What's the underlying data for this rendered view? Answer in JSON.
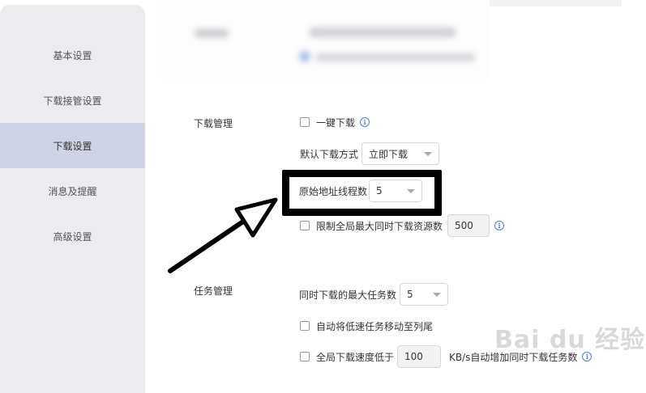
{
  "sidebar": {
    "items": [
      {
        "label": "基本设置"
      },
      {
        "label": "下载接管设置"
      },
      {
        "label": "下载设置"
      },
      {
        "label": "消息及提醒"
      },
      {
        "label": "高级设置"
      }
    ],
    "active_index": 2
  },
  "download_management": {
    "section_label": "下载管理",
    "one_click_download": {
      "label": "一键下载",
      "checked": false
    },
    "default_download_mode": {
      "label": "默认下载方式",
      "value": "立即下载"
    },
    "origin_threads": {
      "label": "原始地址线程数",
      "value": "5"
    },
    "limit_global_resources": {
      "label": "限制全局最大同时下载资源数",
      "checked": false,
      "value": "500"
    }
  },
  "task_management": {
    "section_label": "任务管理",
    "max_concurrent_tasks": {
      "label": "同时下载的最大任务数",
      "value": "5"
    },
    "move_slow_tasks": {
      "label": "自动将低速任务移动至列尾",
      "checked": false
    },
    "global_speed_low": {
      "label": "全局下载速度低于",
      "value": "100",
      "suffix": "KB/s自动增加同时下载任务数",
      "checked": false
    }
  },
  "watermark": {
    "text": "Bai du 经验"
  },
  "colors": {
    "accent": "#4a7fd6",
    "sidebar_active": "#cdd2e4",
    "sidebar_bg": "#ebebf0"
  }
}
